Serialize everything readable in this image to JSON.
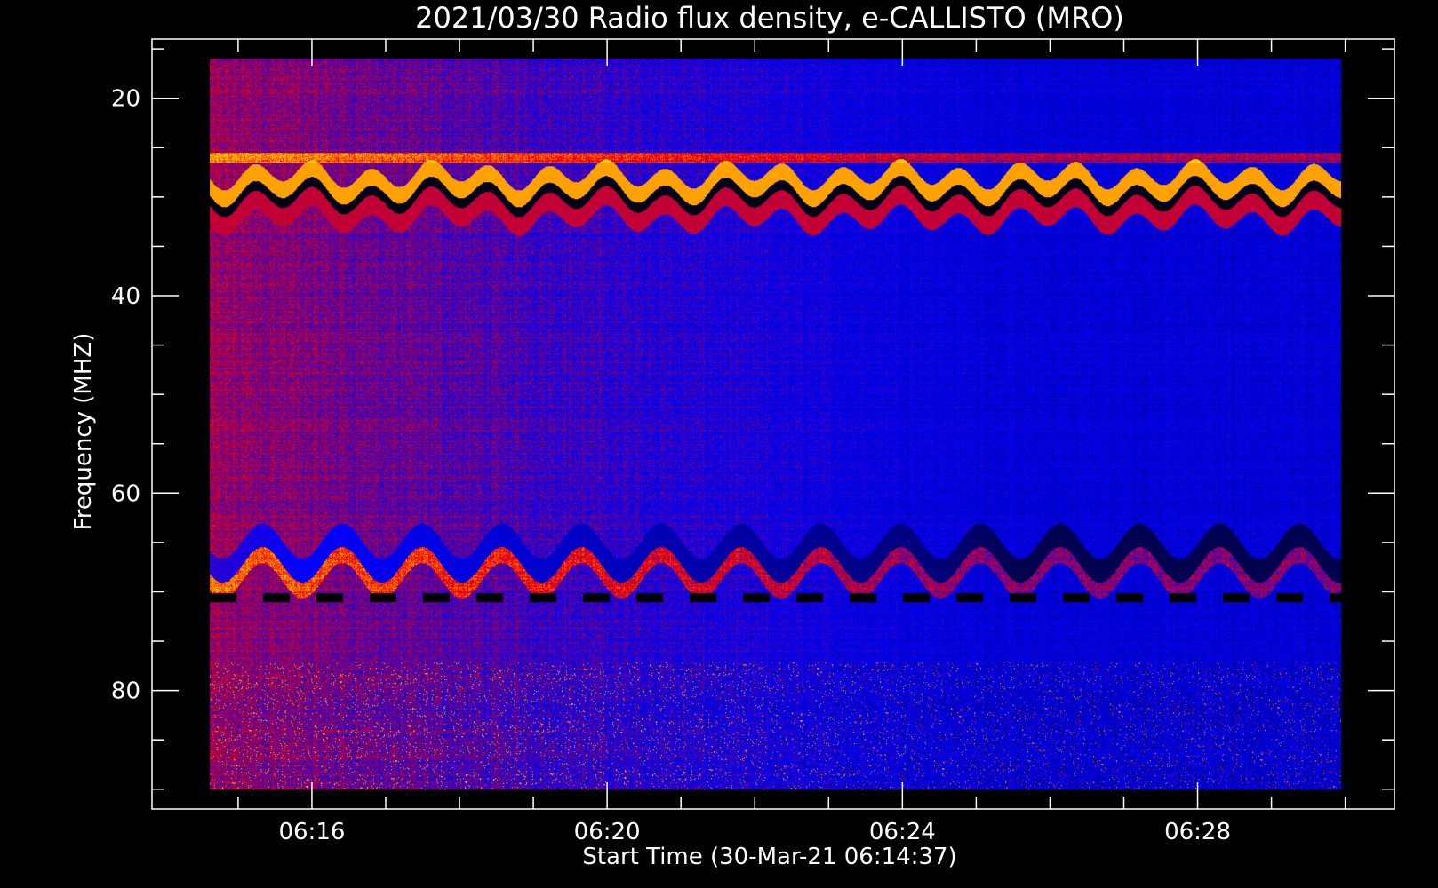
{
  "chart_data": {
    "type": "heatmap",
    "title": "2021/03/30  Radio flux density, e-CALLISTO (MRO)",
    "xlabel": "Start Time (30-Mar-21 06:14:37)",
    "ylabel": "Frequency (MHZ)",
    "x_range_minutes": [
      "06:14:37",
      "06:29:57"
    ],
    "xlim_axis": [
      "06:13:50",
      "06:30:40"
    ],
    "ylim": [
      14,
      92
    ],
    "y_inverted": true,
    "data_freq_range": [
      16,
      90
    ],
    "x_major_ticks": [
      "06:16",
      "06:20",
      "06:24",
      "06:28"
    ],
    "y_major_ticks": [
      20,
      40,
      60,
      80
    ],
    "colormap": [
      "#000000",
      "#0000ff",
      "#800000",
      "#ff2000",
      "#ffd000"
    ],
    "features": [
      {
        "name": "strong oscillating band",
        "freq_mhz": 30
      },
      {
        "name": "faint band",
        "freq_mhz": 26
      },
      {
        "name": "interference dashes",
        "freq_mhz": 70.5
      },
      {
        "name": "oscillating lower band",
        "freq_mhz": 66
      }
    ]
  }
}
